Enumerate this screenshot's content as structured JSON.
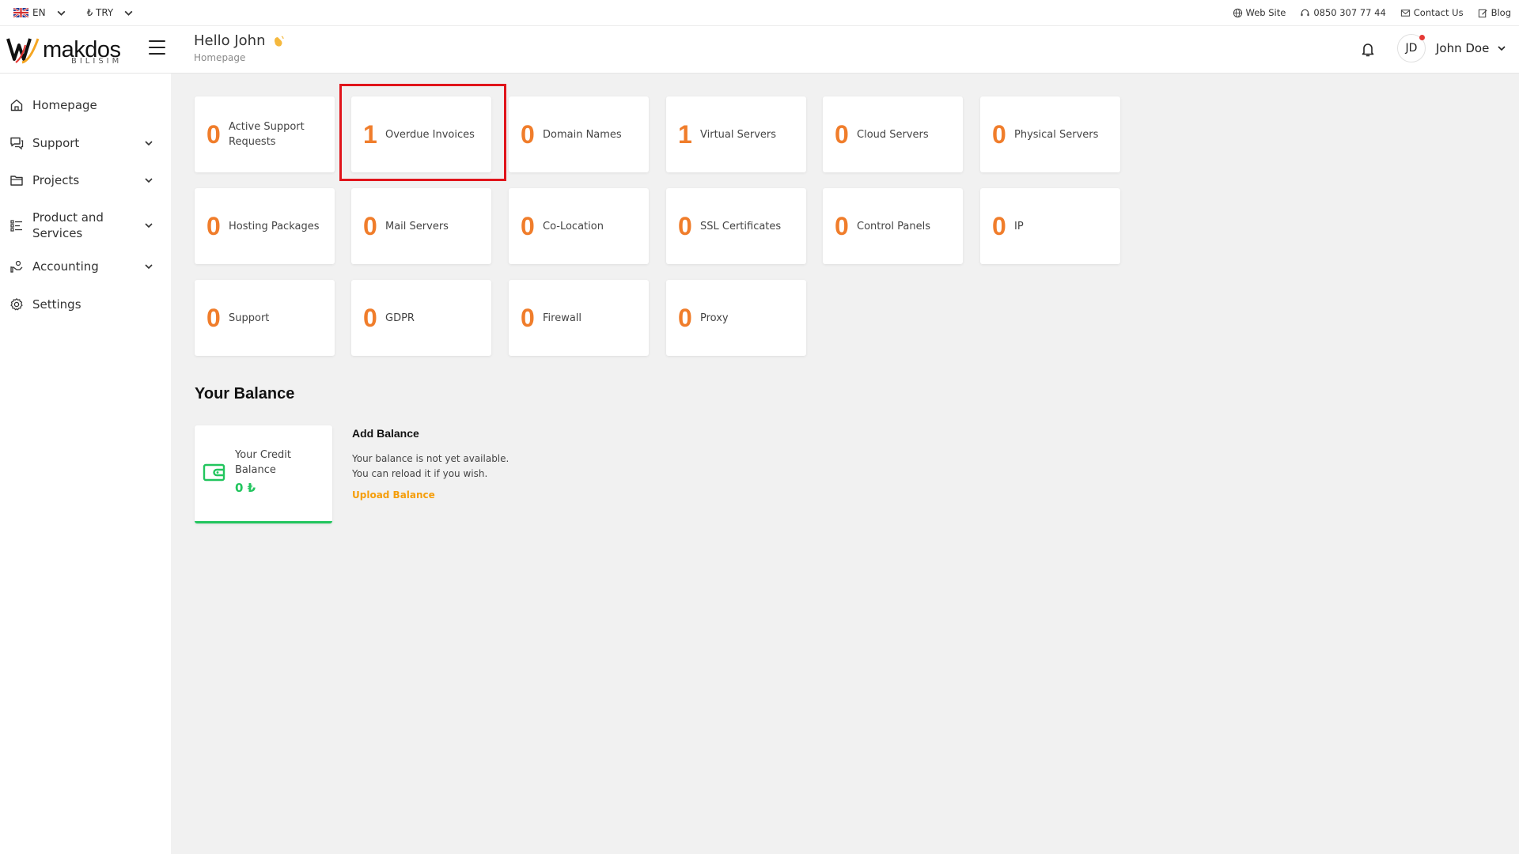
{
  "topbar": {
    "language": "EN",
    "currency": "₺ TRY",
    "links": [
      {
        "label": "Web Site",
        "icon": "globe-icon"
      },
      {
        "label": "0850 307 77 44",
        "icon": "headset-icon"
      },
      {
        "label": "Contact Us",
        "icon": "mail-icon"
      },
      {
        "label": "Blog",
        "icon": "edit-icon"
      }
    ]
  },
  "header": {
    "logo_word": "makdos",
    "logo_sub": "BILISIM",
    "greeting": "Hello John",
    "breadcrumb": "Homepage",
    "user_initials": "JD",
    "user_name": "John Doe"
  },
  "sidebar": {
    "items": [
      {
        "label": "Homepage",
        "icon": "home-icon"
      },
      {
        "label": "Support",
        "icon": "chat-icon"
      },
      {
        "label": "Projects",
        "icon": "folder-icon"
      },
      {
        "label": "Product and Services",
        "icon": "list-icon"
      },
      {
        "label": "Accounting",
        "icon": "hand-coin-icon"
      },
      {
        "label": "Settings",
        "icon": "gear-icon"
      }
    ]
  },
  "stats": [
    {
      "value": "0",
      "label": "Active Support Requests"
    },
    {
      "value": "1",
      "label": "Overdue Invoices"
    },
    {
      "value": "0",
      "label": "Domain Names"
    },
    {
      "value": "1",
      "label": "Virtual Servers"
    },
    {
      "value": "0",
      "label": "Cloud Servers"
    },
    {
      "value": "0",
      "label": "Physical Servers"
    },
    {
      "value": "0",
      "label": "Hosting Packages"
    },
    {
      "value": "0",
      "label": "Mail Servers"
    },
    {
      "value": "0",
      "label": "Co-Location"
    },
    {
      "value": "0",
      "label": "SSL Certificates"
    },
    {
      "value": "0",
      "label": "Control Panels"
    },
    {
      "value": "0",
      "label": "IP"
    },
    {
      "value": "0",
      "label": "Support"
    },
    {
      "value": "0",
      "label": "GDPR"
    },
    {
      "value": "0",
      "label": "Firewall"
    },
    {
      "value": "0",
      "label": "Proxy"
    }
  ],
  "balance": {
    "title": "Your Balance",
    "card_label": "Your Credit Balance",
    "card_value": "0 ₺",
    "add_title": "Add Balance",
    "add_line1": "Your balance is not yet available.",
    "add_line2": "You can reload it if you wish.",
    "upload_label": "Upload Balance"
  },
  "colors": {
    "accent_orange": "#f07d2b",
    "balance_green": "#22c55e",
    "link_orange": "#f59e0b",
    "highlight_red": "#e0141b"
  }
}
